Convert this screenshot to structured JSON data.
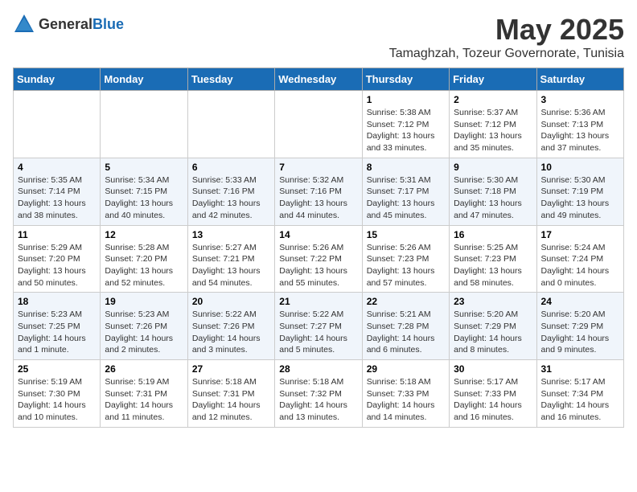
{
  "header": {
    "logo_general": "General",
    "logo_blue": "Blue",
    "month_year": "May 2025",
    "location": "Tamaghzah, Tozeur Governorate, Tunisia"
  },
  "days_of_week": [
    "Sunday",
    "Monday",
    "Tuesday",
    "Wednesday",
    "Thursday",
    "Friday",
    "Saturday"
  ],
  "weeks": [
    [
      {
        "day": "",
        "info": ""
      },
      {
        "day": "",
        "info": ""
      },
      {
        "day": "",
        "info": ""
      },
      {
        "day": "",
        "info": ""
      },
      {
        "day": "1",
        "info": "Sunrise: 5:38 AM\nSunset: 7:12 PM\nDaylight: 13 hours\nand 33 minutes."
      },
      {
        "day": "2",
        "info": "Sunrise: 5:37 AM\nSunset: 7:12 PM\nDaylight: 13 hours\nand 35 minutes."
      },
      {
        "day": "3",
        "info": "Sunrise: 5:36 AM\nSunset: 7:13 PM\nDaylight: 13 hours\nand 37 minutes."
      }
    ],
    [
      {
        "day": "4",
        "info": "Sunrise: 5:35 AM\nSunset: 7:14 PM\nDaylight: 13 hours\nand 38 minutes."
      },
      {
        "day": "5",
        "info": "Sunrise: 5:34 AM\nSunset: 7:15 PM\nDaylight: 13 hours\nand 40 minutes."
      },
      {
        "day": "6",
        "info": "Sunrise: 5:33 AM\nSunset: 7:16 PM\nDaylight: 13 hours\nand 42 minutes."
      },
      {
        "day": "7",
        "info": "Sunrise: 5:32 AM\nSunset: 7:16 PM\nDaylight: 13 hours\nand 44 minutes."
      },
      {
        "day": "8",
        "info": "Sunrise: 5:31 AM\nSunset: 7:17 PM\nDaylight: 13 hours\nand 45 minutes."
      },
      {
        "day": "9",
        "info": "Sunrise: 5:30 AM\nSunset: 7:18 PM\nDaylight: 13 hours\nand 47 minutes."
      },
      {
        "day": "10",
        "info": "Sunrise: 5:30 AM\nSunset: 7:19 PM\nDaylight: 13 hours\nand 49 minutes."
      }
    ],
    [
      {
        "day": "11",
        "info": "Sunrise: 5:29 AM\nSunset: 7:20 PM\nDaylight: 13 hours\nand 50 minutes."
      },
      {
        "day": "12",
        "info": "Sunrise: 5:28 AM\nSunset: 7:20 PM\nDaylight: 13 hours\nand 52 minutes."
      },
      {
        "day": "13",
        "info": "Sunrise: 5:27 AM\nSunset: 7:21 PM\nDaylight: 13 hours\nand 54 minutes."
      },
      {
        "day": "14",
        "info": "Sunrise: 5:26 AM\nSunset: 7:22 PM\nDaylight: 13 hours\nand 55 minutes."
      },
      {
        "day": "15",
        "info": "Sunrise: 5:26 AM\nSunset: 7:23 PM\nDaylight: 13 hours\nand 57 minutes."
      },
      {
        "day": "16",
        "info": "Sunrise: 5:25 AM\nSunset: 7:23 PM\nDaylight: 13 hours\nand 58 minutes."
      },
      {
        "day": "17",
        "info": "Sunrise: 5:24 AM\nSunset: 7:24 PM\nDaylight: 14 hours\nand 0 minutes."
      }
    ],
    [
      {
        "day": "18",
        "info": "Sunrise: 5:23 AM\nSunset: 7:25 PM\nDaylight: 14 hours\nand 1 minute."
      },
      {
        "day": "19",
        "info": "Sunrise: 5:23 AM\nSunset: 7:26 PM\nDaylight: 14 hours\nand 2 minutes."
      },
      {
        "day": "20",
        "info": "Sunrise: 5:22 AM\nSunset: 7:26 PM\nDaylight: 14 hours\nand 3 minutes."
      },
      {
        "day": "21",
        "info": "Sunrise: 5:22 AM\nSunset: 7:27 PM\nDaylight: 14 hours\nand 5 minutes."
      },
      {
        "day": "22",
        "info": "Sunrise: 5:21 AM\nSunset: 7:28 PM\nDaylight: 14 hours\nand 6 minutes."
      },
      {
        "day": "23",
        "info": "Sunrise: 5:20 AM\nSunset: 7:29 PM\nDaylight: 14 hours\nand 8 minutes."
      },
      {
        "day": "24",
        "info": "Sunrise: 5:20 AM\nSunset: 7:29 PM\nDaylight: 14 hours\nand 9 minutes."
      }
    ],
    [
      {
        "day": "25",
        "info": "Sunrise: 5:19 AM\nSunset: 7:30 PM\nDaylight: 14 hours\nand 10 minutes."
      },
      {
        "day": "26",
        "info": "Sunrise: 5:19 AM\nSunset: 7:31 PM\nDaylight: 14 hours\nand 11 minutes."
      },
      {
        "day": "27",
        "info": "Sunrise: 5:18 AM\nSunset: 7:31 PM\nDaylight: 14 hours\nand 12 minutes."
      },
      {
        "day": "28",
        "info": "Sunrise: 5:18 AM\nSunset: 7:32 PM\nDaylight: 14 hours\nand 13 minutes."
      },
      {
        "day": "29",
        "info": "Sunrise: 5:18 AM\nSunset: 7:33 PM\nDaylight: 14 hours\nand 14 minutes."
      },
      {
        "day": "30",
        "info": "Sunrise: 5:17 AM\nSunset: 7:33 PM\nDaylight: 14 hours\nand 16 minutes."
      },
      {
        "day": "31",
        "info": "Sunrise: 5:17 AM\nSunset: 7:34 PM\nDaylight: 14 hours\nand 16 minutes."
      }
    ]
  ]
}
